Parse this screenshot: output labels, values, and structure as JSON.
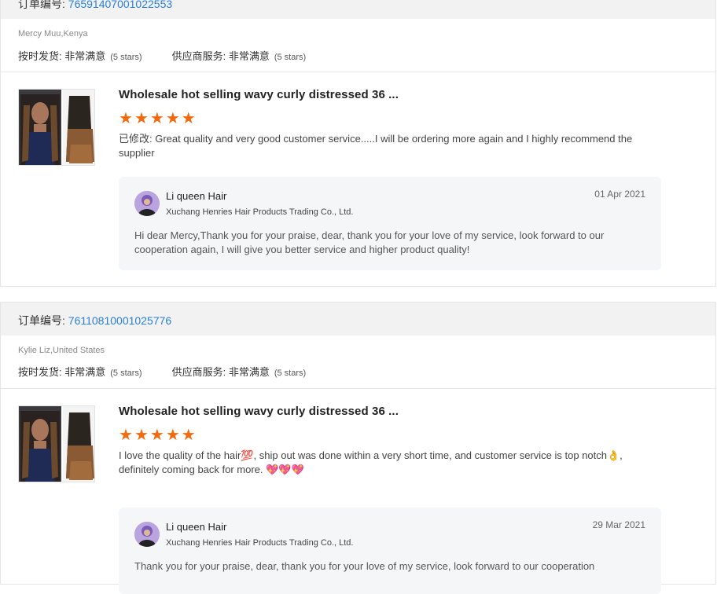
{
  "order_label": "订单编号: ",
  "orders": [
    {
      "order_number": "76591407001022553",
      "buyer": "Mercy Muu,Kenya",
      "ship_label": "按时发货: ",
      "ship_value": "非常满意",
      "ship_stars": "(5 stars)",
      "service_label": "供应商服务: ",
      "service_value": "非常满意",
      "service_stars": "(5 stars)",
      "product_title": "Wholesale hot selling wavy curly distressed 36 ...",
      "rating": 5,
      "review_prefix": "已修改: ",
      "review_text": "Great quality and very good customer service.....I will be ordering more again and I highly recommend the supplier",
      "reply": {
        "seller": "Li queen Hair",
        "company": "Xuchang Henries Hair Products Trading Co., Ltd.",
        "date": "01 Apr 2021",
        "text": "Hi dear Mercy,Thank you for your praise, dear, thank you for your love of my service, look forward to our cooperation again, I will give you better service and higher product quality!"
      }
    },
    {
      "order_number": "76110810001025776",
      "buyer": "Kylie Liz,United States",
      "ship_label": "按时发货: ",
      "ship_value": "非常满意",
      "ship_stars": "(5 stars)",
      "service_label": "供应商服务: ",
      "service_value": "非常满意",
      "service_stars": "(5 stars)",
      "product_title": "Wholesale hot selling wavy curly distressed 36 ...",
      "rating": 5,
      "review_line1": "I love the quality of the hair💯, ship out was done within a very short time, and customer service is top notch👌,",
      "review_line2": "definitely coming back for more. 💖💖💖",
      "reply": {
        "seller": "Li queen Hair",
        "company": "Xuchang Henries Hair Products Trading Co., Ltd.",
        "date": "29 Mar 2021",
        "text": "Thank you for your praise, dear, thank you for your love of my service, look forward to our cooperation"
      }
    }
  ],
  "colors": {
    "star": "#f26a0d",
    "link": "#2a7fd4",
    "header_bg": "#f2f2f2",
    "reply_bg": "#f5f6f8"
  },
  "icons": {
    "star": "star-icon",
    "avatar": "seller-avatar"
  }
}
